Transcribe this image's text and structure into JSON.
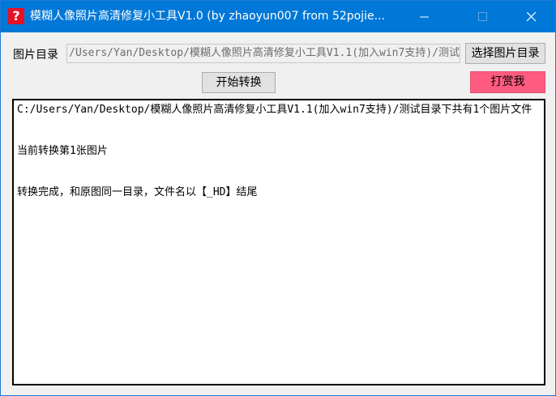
{
  "window": {
    "title": "模糊人像照片高清修复小工具V1.0  (by zhaoyun007 from 52pojie...",
    "icon_glyph": "?",
    "icon": "question-mark-icon",
    "controls": {
      "minimize_icon": "minimize-icon",
      "maximize_icon": "maximize-icon",
      "close_icon": "close-icon"
    }
  },
  "form": {
    "dir_label": "图片目录",
    "dir_path": "C:/Users/Yan/Desktop/模糊人像照片高清修复小工具V1.1(加入win7支持)/测试",
    "choose_button": "选择图片目录",
    "start_button": "开始转换",
    "reward_button": "打赏我"
  },
  "log": {
    "lines": [
      "C:/Users/Yan/Desktop/模糊人像照片高清修复小工具V1.1(加入win7支持)/测试目录下共有1个图片文件",
      "",
      "",
      "当前转换第1张图片",
      "",
      "",
      "转换完成，和原图同一目录，文件名以【_HD】结尾"
    ]
  },
  "colors": {
    "titlebar": "#0078d7",
    "reward_button": "#ff5b7f",
    "app_icon": "#e81123"
  }
}
